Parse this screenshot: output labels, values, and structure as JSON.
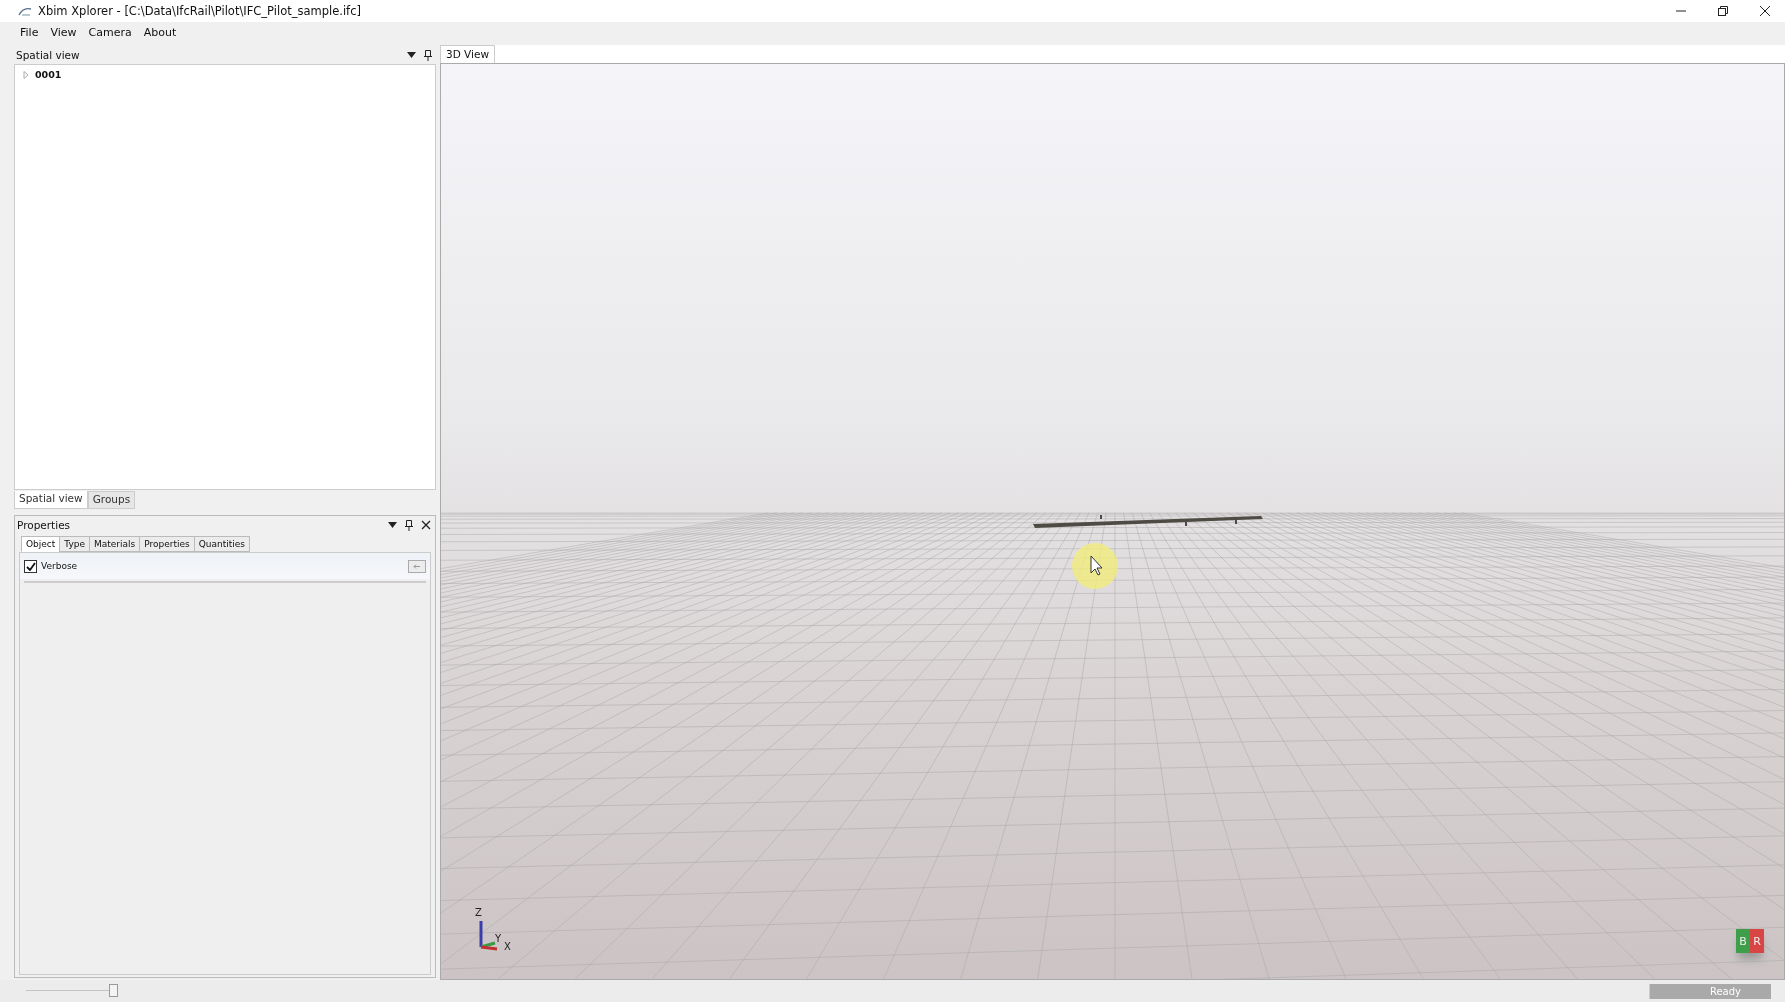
{
  "window": {
    "title": "Xbim Xplorer - [C:\\Data\\IfcRail\\Pilot\\IFC_Pilot_sample.ifc]"
  },
  "menu": [
    "File",
    "View",
    "Camera",
    "About"
  ],
  "spatial_panel": {
    "title": "Spatial view",
    "tree": [
      {
        "label": "0001",
        "expanded": false
      }
    ]
  },
  "left_tabs": [
    {
      "label": "Spatial view",
      "selected": true
    },
    {
      "label": "Groups",
      "selected": false
    }
  ],
  "properties_panel": {
    "title": "Properties",
    "tabs": [
      {
        "label": "Object",
        "selected": true
      },
      {
        "label": "Type",
        "selected": false
      },
      {
        "label": "Materials",
        "selected": false
      },
      {
        "label": "Properties",
        "selected": false
      },
      {
        "label": "Quantities",
        "selected": false
      }
    ],
    "verbose": {
      "label": "Verbose",
      "checked": true
    }
  },
  "view_tab": {
    "label": "3D View",
    "selected": true
  },
  "axes": {
    "z": "Z",
    "y": "Y",
    "x": "X"
  },
  "view_cube": {
    "left": "B",
    "right": "R"
  },
  "status_bar": {
    "zoom": {
      "level": 1
    },
    "status": "Ready"
  }
}
